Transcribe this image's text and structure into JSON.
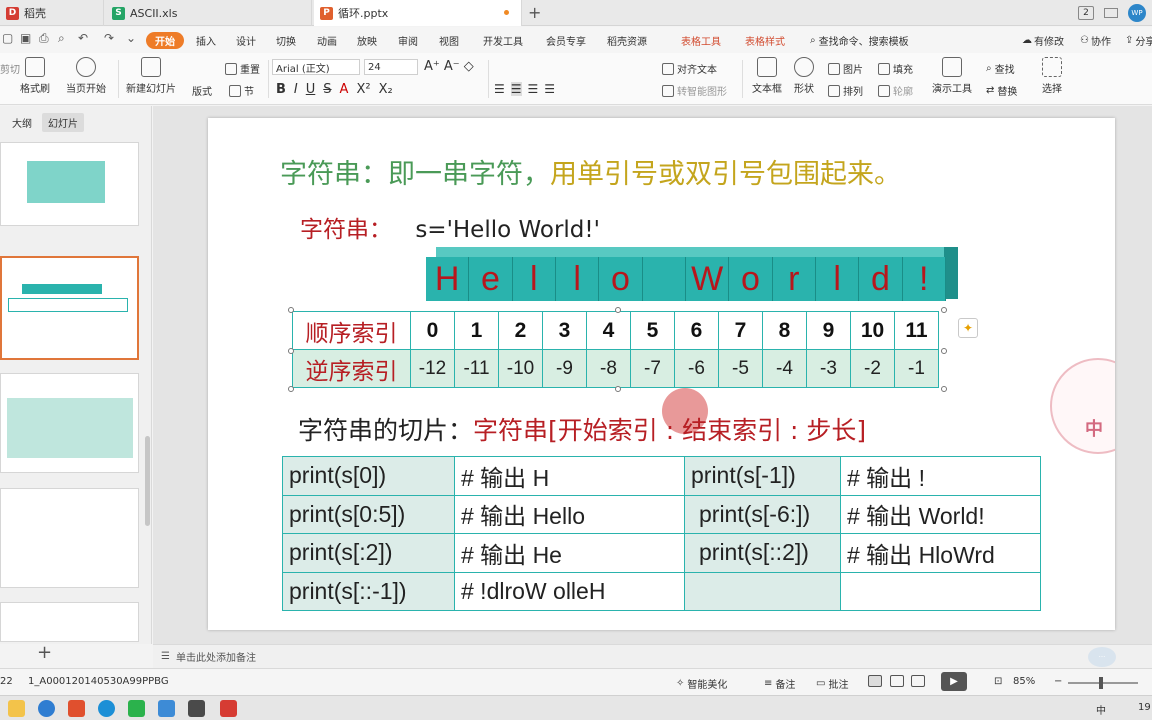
{
  "tabs": [
    {
      "label": "稻壳",
      "icon": "D",
      "color": "#d43c33"
    },
    {
      "label": "ASCII.xls",
      "icon": "S",
      "color": "#24a465"
    },
    {
      "label": "循环.pptx",
      "icon": "P",
      "color": "#e0602e"
    }
  ],
  "window": {
    "badge": "2",
    "avatar": "WP"
  },
  "menu": {
    "start": "开始",
    "insert": "插入",
    "design": "设计",
    "transition": "切换",
    "animation": "动画",
    "slideshow": "放映",
    "review": "审阅",
    "view": "视图",
    "dev": "开发工具",
    "member": "会员专享",
    "daoke": "稻壳资源",
    "table_tools": "表格工具",
    "table_style": "表格样式",
    "search": "查找命令、搜索模板",
    "has_changes": "有修改",
    "collab": "协作",
    "share": "分享"
  },
  "ribbon": {
    "cut": "剪切",
    "format_painter": "格式刷",
    "from_current": "当页开始",
    "new_slide": "新建幻灯片",
    "layout": "版式",
    "section": "节",
    "reset": "重置",
    "font_name": "Arial (正文)",
    "font_size": "24",
    "align_text": "对齐文本",
    "smartart": "转智能图形",
    "textbox": "文本框",
    "shape": "形状",
    "arrange": "排列",
    "picture": "图片",
    "fill": "填充",
    "outline": "轮廓",
    "find": "查找",
    "replace": "替换",
    "slideshow_tool": "演示工具",
    "select": "选择"
  },
  "left_panel": {
    "tab_outline": "大纲",
    "tab_slides": "幻灯片"
  },
  "slide": {
    "title_part1": "字符串：即一串字符，",
    "title_part2": "用单引号或双引号包围起来。",
    "def_label": "字符串：",
    "def_code": "s='Hello World!'",
    "chars": [
      "H",
      "e",
      "l",
      "l",
      "o",
      "",
      "W",
      "o",
      "r",
      "l",
      "d",
      "!"
    ],
    "pos_label": "顺序索引",
    "pos_indices": [
      "0",
      "1",
      "2",
      "3",
      "4",
      "5",
      "6",
      "7",
      "8",
      "9",
      "10",
      "11"
    ],
    "neg_label": "逆序索引",
    "neg_indices": [
      "-12",
      "-11",
      "-10",
      "-9",
      "-8",
      "-7",
      "-6",
      "-5",
      "-4",
      "-3",
      "-2",
      "-1"
    ],
    "slice_label": "字符串的切片：",
    "slice_syntax": "字符串[开始索引 : 结束索引 : 步长]",
    "examples": [
      [
        "print(s[0])",
        "# 输出 H",
        "print(s[-1])",
        "# 输出 !"
      ],
      [
        "print(s[0:5])",
        "# 输出 Hello",
        "print(s[-6:])",
        "# 输出 World!"
      ],
      [
        "print(s[:2])",
        "# 输出 He",
        "print(s[::2])",
        "# 输出 HloWrd"
      ],
      [
        "print(s[::-1])",
        "# !dlroW olleH",
        "",
        ""
      ]
    ],
    "stamp_text": "中"
  },
  "notes": {
    "placeholder": "单击此处添加备注"
  },
  "status": {
    "slide_num": "22",
    "file_id": "1_A000120140530A99PPBG",
    "beautify": "智能美化",
    "notes": "备注",
    "comments": "批注",
    "zoom": "85%"
  },
  "taskbar": {
    "ime": "中",
    "time": "19"
  }
}
